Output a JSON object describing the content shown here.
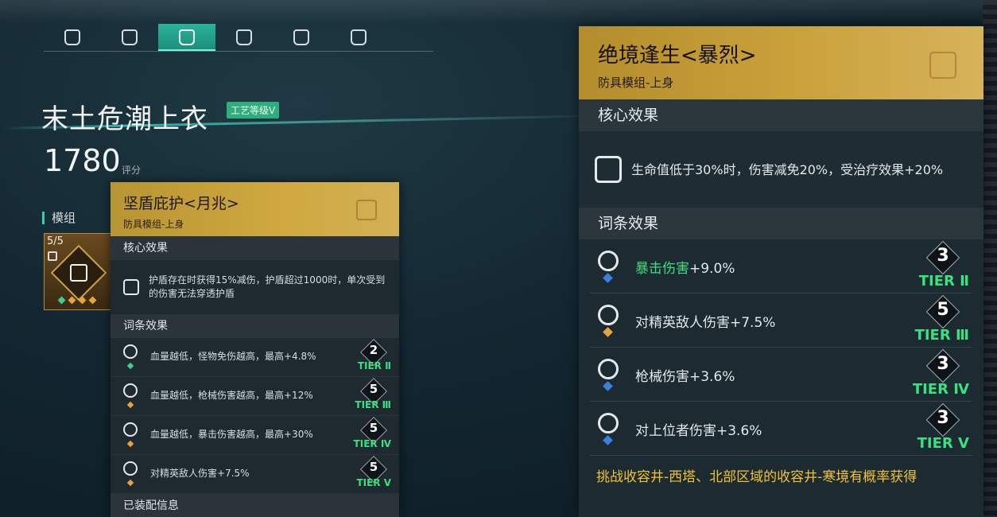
{
  "tabs": [
    {
      "icon": "helmet-icon",
      "active": false
    },
    {
      "icon": "mask-icon",
      "active": false
    },
    {
      "icon": "chest-armor-icon",
      "active": true
    },
    {
      "icon": "gloves-icon",
      "active": false
    },
    {
      "icon": "backpack-icon",
      "active": false
    },
    {
      "icon": "pants-icon",
      "active": false
    }
  ],
  "item": {
    "title": "末土危潮上衣",
    "craft_badge": "工艺等级Ⅴ",
    "score": "1780",
    "score_label": "评分",
    "mod_section": "模组",
    "mod_count": "5/5"
  },
  "left_popup": {
    "name": "坚盾庇护<月兆>",
    "subtitle": "防具模组-上身",
    "core_header": "核心效果",
    "core_text": "护盾存在时获得15%减伤，护盾超过1000时，单次受到的伤害无法穿透护盾",
    "affix_header": "词条效果",
    "affixes": [
      {
        "text": "血量越低，怪物免伤越高，最高+4.8%",
        "level": "2",
        "tier": "TIER Ⅱ",
        "dot": "green"
      },
      {
        "text": "血量越低，枪械伤害越高，最高+12%",
        "level": "5",
        "tier": "TIER Ⅲ",
        "dot": "orange"
      },
      {
        "text": "血量越低，暴击伤害越高，最高+30%",
        "level": "5",
        "tier": "TIER Ⅳ",
        "dot": "orange"
      },
      {
        "text": "对精英敌人伤害+7.5%",
        "level": "5",
        "tier": "TIER Ⅴ",
        "dot": "orange"
      }
    ],
    "equipped_header": "已装配信息"
  },
  "right_panel": {
    "name": "绝境逢生<暴烈>",
    "subtitle": "防具模组-上身",
    "core_header": "核心效果",
    "core_text": "生命值低于30%时，伤害减免20%，受治疗效果+20%",
    "affix_header": "词条效果",
    "affixes": [
      {
        "highlight": "暴击伤害",
        "text": "+9.0%",
        "level": "3",
        "tier": "TIER Ⅱ",
        "dot": "blue"
      },
      {
        "highlight": "",
        "text": "对精英敌人伤害+7.5%",
        "level": "5",
        "tier": "TIER Ⅲ",
        "dot": "orange"
      },
      {
        "highlight": "",
        "text": "枪械伤害+3.6%",
        "level": "3",
        "tier": "TIER Ⅳ",
        "dot": "blue"
      },
      {
        "highlight": "",
        "text": "对上位者伤害+3.6%",
        "level": "3",
        "tier": "TIER Ⅴ",
        "dot": "blue"
      }
    ],
    "source": "挑战收容井-西塔、北部区域的收容井-寒境有概率获得"
  },
  "colors": {
    "gold": "#cfa83f",
    "teal": "#2bb39a",
    "tier_green": "#3be07f",
    "source_yellow": "#f1c232"
  }
}
